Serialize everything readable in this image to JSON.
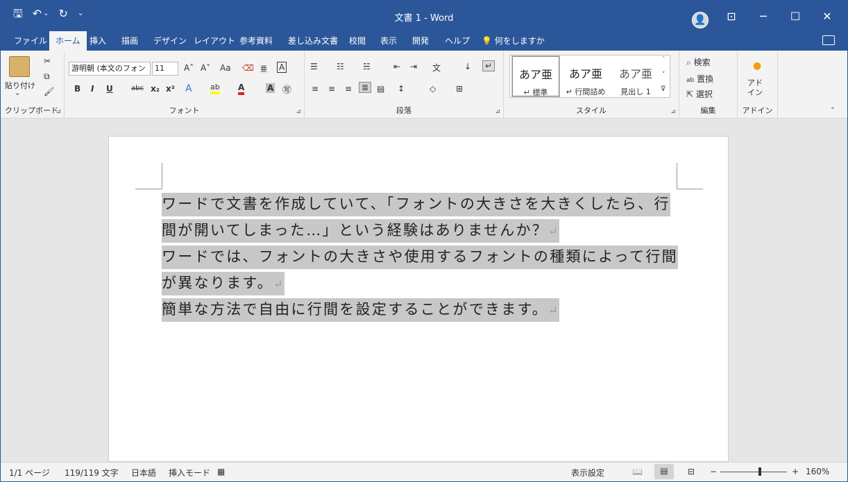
{
  "window": {
    "title": "文書 1  -  Word"
  },
  "qat": {
    "save": "🖫",
    "undo": "↶",
    "undo_drop": "⌄",
    "redo": "↻",
    "customize": "⌄"
  },
  "title_controls": {
    "avatar": "👤",
    "display_options": "⊡",
    "minimize": "─",
    "maximize": "☐",
    "close": "✕"
  },
  "tabs": [
    {
      "label": "ファイル"
    },
    {
      "label": "ホーム"
    },
    {
      "label": "挿入"
    },
    {
      "label": "描画"
    },
    {
      "label": "デザイン"
    },
    {
      "label": "レイアウト"
    },
    {
      "label": "参考資料"
    },
    {
      "label": "差し込み文書"
    },
    {
      "label": "校閲"
    },
    {
      "label": "表示"
    },
    {
      "label": "開発"
    },
    {
      "label": "ヘルプ"
    }
  ],
  "tell_me": {
    "icon": "💡",
    "label": "何をしますか"
  },
  "ribbon": {
    "clipboard": {
      "paste": "貼り付け",
      "paste_drop": "⌄",
      "cut": "✂",
      "copy": "⧉",
      "format_painter": "🖌",
      "label": "クリップボード",
      "launcher": "⊿"
    },
    "font": {
      "name": "游明朝 (本文のフォン",
      "size": "11",
      "grow": "A˄",
      "shrink": "A˅",
      "change_case": "Aa",
      "clear": "⌫",
      "phonetic": "亜",
      "border": "A",
      "bold": "B",
      "italic": "I",
      "underline": "U",
      "strike": "abc",
      "subscript": "x₂",
      "superscript": "x²",
      "text_effects": "A",
      "highlight": "ab",
      "font_color": "A",
      "shading": "A",
      "enclose": "㊢",
      "label": "フォント",
      "launcher": "⊿"
    },
    "paragraph": {
      "bullets": "☰",
      "numbering": "☷",
      "multilevel": "☵",
      "dec_indent": "⇤",
      "inc_indent": "⇥",
      "asian_layout": "文",
      "sort": "↓",
      "show_marks": "↵",
      "align_left": "≡",
      "center": "≡",
      "align_right": "≡",
      "justify": "≣",
      "distributed": "▤",
      "line_spacing": "↕",
      "shading": "◇",
      "borders": "⊞",
      "label": "段落",
      "launcher": "⊿"
    },
    "styles": {
      "items": [
        {
          "preview": "あア亜",
          "name": "↵ 標準"
        },
        {
          "preview": "あア亜",
          "name": "↵ 行間詰め"
        },
        {
          "preview": "あア亜",
          "name": "見出し 1"
        }
      ],
      "label": "スタイル",
      "launcher": "⊿",
      "up": "˄",
      "down": "˅",
      "more": "⊽"
    },
    "editing": {
      "find": "検索",
      "find_icon": "⌕",
      "replace": "置換",
      "replace_icon": "ab",
      "select": "選択",
      "select_icon": "⇱",
      "label": "編集"
    },
    "addins": {
      "button": "アド\nイン",
      "icon": "●",
      "label": "アドイン"
    },
    "collapse": "˄"
  },
  "document": {
    "lines": [
      {
        "text": "ワードで文書を作成していて、「フォントの大きさを大きくしたら、行",
        "mark": ""
      },
      {
        "text": "間が開いてしまった…」という経験はありませんか？",
        "mark": "↵"
      },
      {
        "text": "ワードでは、フォントの大きさや使用するフォントの種類によって行間",
        "mark": ""
      },
      {
        "text": "が異なります。",
        "mark": "↵"
      },
      {
        "text": "簡単な方法で自由に行間を設定することができます。",
        "mark": "↵"
      }
    ]
  },
  "status": {
    "page": "1/1 ページ",
    "words": "119/119 文字",
    "language": "日本語",
    "mode": "挿入モード",
    "macro_icon": "▦",
    "display_settings": "表示設定",
    "read_mode": "📖",
    "print_layout": "▤",
    "web_layout": "⊟",
    "zoom_out": "−",
    "zoom_in": "+",
    "zoom": "160%",
    "zoom_percent": 160
  },
  "colors": {
    "accent": "#2b579a",
    "selection": "#c8c8c8",
    "ribbon_bg": "#f3f3f3"
  }
}
